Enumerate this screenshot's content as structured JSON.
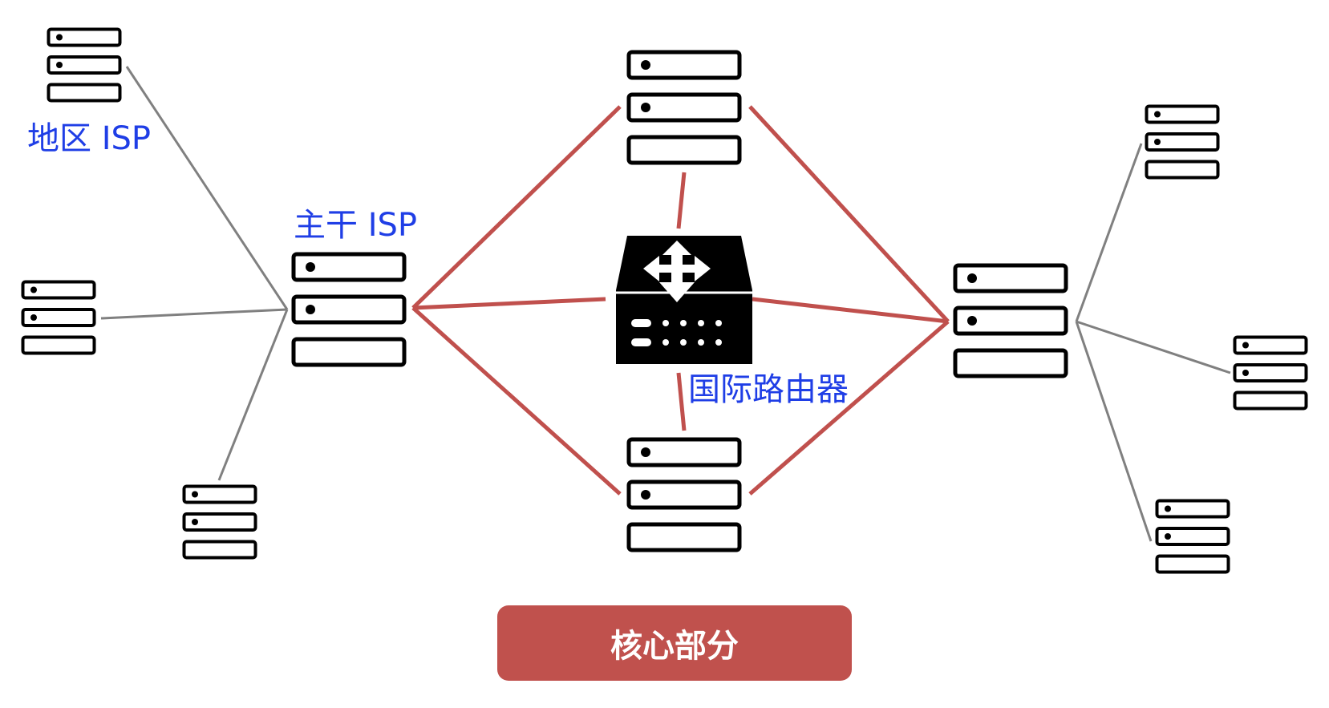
{
  "labels": {
    "regional_isp": "地区 ISP",
    "backbone_isp": "主干 ISP",
    "international_router": "国际路由器",
    "core": "核心部分"
  },
  "colors": {
    "label_text": "#1f3ee6",
    "core_link": "#c0504d",
    "access_link": "#808080",
    "icon": "#000000",
    "badge_bg": "#c0514d",
    "badge_text": "#ffffff"
  },
  "icons": {
    "server": "server-rack-icon",
    "router": "router-icon"
  }
}
